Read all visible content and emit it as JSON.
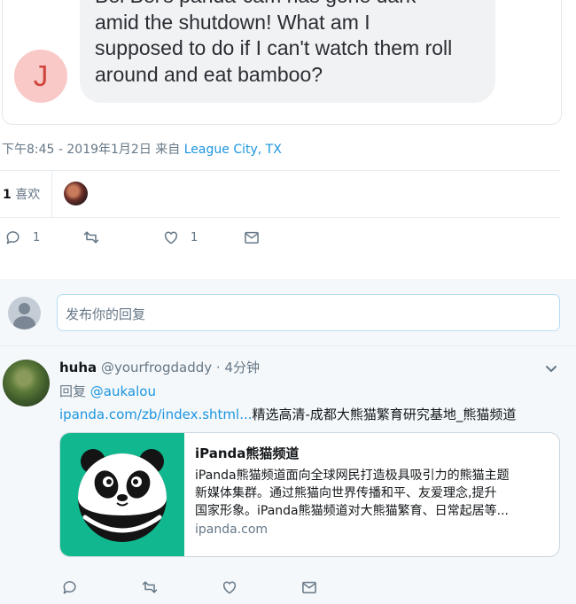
{
  "tweet": {
    "avatar_letter": "J",
    "text_lines": [
      "Bei Bei's panda-cam has gone dark",
      "amid the shutdown! What am I",
      "supposed to do if I can't watch them roll",
      "around and eat bamboo?"
    ],
    "timestamp": "下午8:45 - 2019年1月2日",
    "from_label": "来自",
    "location": "League City, TX",
    "likes_count": "1",
    "likes_label": "喜欢",
    "reply_count": "1",
    "like_count": "1"
  },
  "compose": {
    "placeholder": "发布你的回复"
  },
  "reply": {
    "name": "huha",
    "handle": "@yourfrogdaddy",
    "time": "· 4分钟",
    "replying_label": "回复",
    "replying_to": "@aukalou",
    "link_text": "ipanda.com/zb/index.shtml...",
    "text_after_link": "精选高清-成都大熊猫繁育研究基地_熊猫频道",
    "card": {
      "title": "iPanda熊猫频道",
      "desc_lines": [
        "iPanda熊猫频道面向全球网民打造极具吸引力的熊猫主题",
        "新媒体集群。通过熊猫向世界传播和平、友爱理念,提升",
        "国家形象。iPanda熊猫频道对大熊猫繁育、日常起居等..."
      ],
      "domain": "ipanda.com"
    }
  },
  "colors": {
    "accent": "#1b95e0",
    "muted": "#657786",
    "card_thumb_bg": "#11b88f"
  },
  "icons": [
    "reply-icon",
    "retweet-icon",
    "heart-icon",
    "message-icon",
    "chevron-down-icon"
  ]
}
